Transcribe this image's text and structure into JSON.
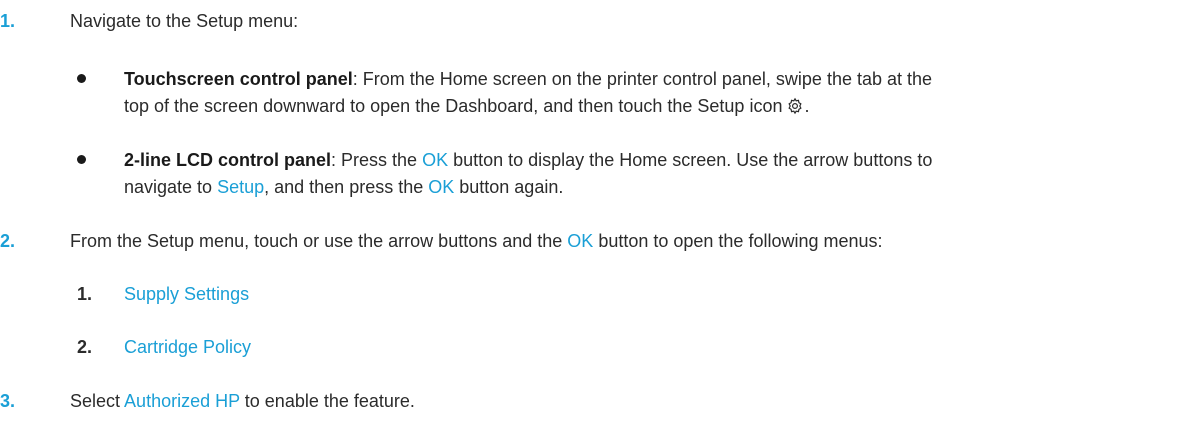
{
  "steps": [
    {
      "number": "1.",
      "text": "Navigate to the Setup menu:",
      "bullets": [
        {
          "title": "Touchscreen control panel",
          "line1": ": From the Home screen on the printer control panel, swipe the tab at the",
          "line2": "top of the screen downward to open the Dashboard, and then touch the Setup icon",
          "icon": "gear-icon"
        },
        {
          "title": "2-line LCD control panel",
          "l1_a": ": Press the ",
          "l1_b": "OK",
          "l1_c": " button to display the Home screen. Use the arrow buttons to",
          "l2_a": "navigate to ",
          "l2_b": "Setup",
          "l2_c": ", and then press the ",
          "l2_d": "OK",
          "l2_e": " button again."
        }
      ]
    },
    {
      "number": "2.",
      "a": "From the Setup menu, touch or use the arrow buttons and the ",
      "b": "OK",
      "c": " button to open the following menus:",
      "substeps": [
        {
          "number": "1.",
          "text": "Supply Settings"
        },
        {
          "number": "2.",
          "text": "Cartridge Policy"
        }
      ]
    },
    {
      "number": "3.",
      "a": "Select ",
      "b": "Authorized HP",
      "c": " to enable the feature."
    }
  ],
  "colors": {
    "accent": "#1a9fd6",
    "text": "#2b2b2b"
  }
}
